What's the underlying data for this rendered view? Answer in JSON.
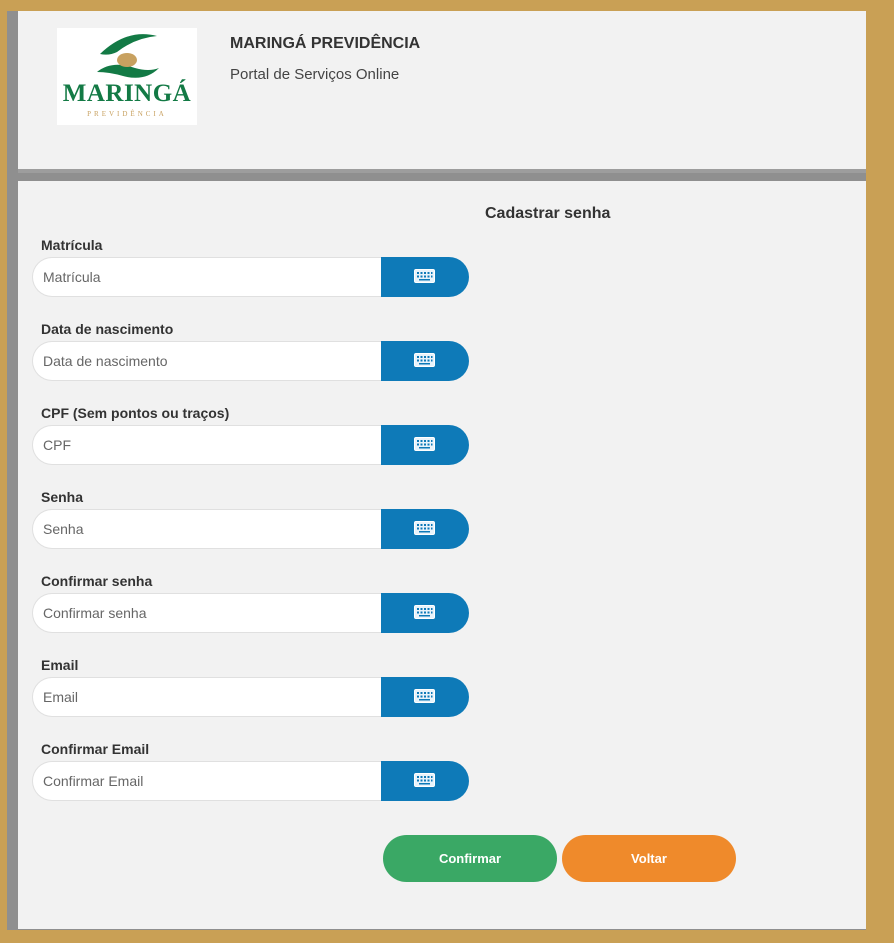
{
  "header": {
    "logo": {
      "word": "MARINGÁ",
      "sub": "PREVIDÊNCIA"
    },
    "title": "MARINGÁ PREVIDÊNCIA",
    "subtitle": "Portal de Serviços Online"
  },
  "form": {
    "title": "Cadastrar senha",
    "fields": [
      {
        "label": "Matrícula",
        "placeholder": "Matrícula"
      },
      {
        "label": "Data de nascimento",
        "placeholder": "Data de nascimento"
      },
      {
        "label": "CPF (Sem pontos ou traços)",
        "placeholder": "CPF"
      },
      {
        "label": "Senha",
        "placeholder": "Senha"
      },
      {
        "label": "Confirmar senha",
        "placeholder": "Confirmar senha"
      },
      {
        "label": "Email",
        "placeholder": "Email"
      },
      {
        "label": "Confirmar Email",
        "placeholder": "Confirmar Email"
      }
    ],
    "keyboard_icon": "keyboard-icon",
    "confirm_label": "Confirmar",
    "back_label": "Voltar"
  },
  "colors": {
    "border": "#c9a055",
    "keyboard_button": "#0e7ab8",
    "confirm": "#3aa865",
    "back": "#ef8a2b",
    "logo_green": "#137a45",
    "logo_gold": "#c8a160"
  }
}
